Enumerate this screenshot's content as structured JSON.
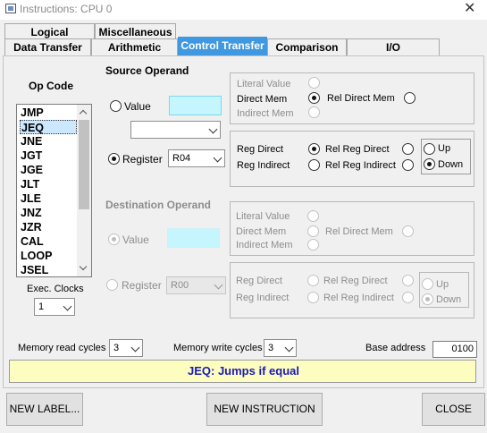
{
  "window": {
    "title": "Instructions: CPU 0",
    "close_glyph": "✕"
  },
  "tabs_row1": [
    "Logical",
    "Miscellaneous"
  ],
  "tabs_row2": [
    "Data Transfer",
    "Arithmetic",
    "Control Transfer",
    "Comparison",
    "I/O"
  ],
  "active_tab": "Control Transfer",
  "opcode": {
    "heading": "Op Code",
    "items": [
      "JMP",
      "JEQ",
      "JNE",
      "JGT",
      "JGE",
      "JLT",
      "JLE",
      "JNZ",
      "JZR",
      "CAL",
      "LOOP",
      "JSEL"
    ],
    "selected": "JEQ",
    "exec_clocks_label": "Exec. Clocks",
    "exec_clocks_value": "1"
  },
  "source": {
    "heading": "Source Operand",
    "value_label": "Value",
    "register_label": "Register",
    "register_value": "R04",
    "literal_label": "Literal Value",
    "direct_mem_label": "Direct Mem",
    "rel_direct_mem_label": "Rel Direct Mem",
    "indirect_mem_label": "Indirect Mem",
    "reg_direct_label": "Reg Direct",
    "rel_reg_direct_label": "Rel Reg Direct",
    "reg_indirect_label": "Reg Indirect",
    "rel_reg_indirect_label": "Rel Reg Indirect",
    "up_label": "Up",
    "down_label": "Down"
  },
  "destination": {
    "heading": "Destination Operand",
    "value_label": "Value",
    "register_label": "Register",
    "register_value": "R00",
    "literal_label": "Literal Value",
    "direct_mem_label": "Direct Mem",
    "rel_direct_mem_label": "Rel Direct Mem",
    "indirect_mem_label": "Indirect Mem",
    "reg_direct_label": "Reg Direct",
    "rel_reg_direct_label": "Rel Reg Direct",
    "reg_indirect_label": "Reg Indirect",
    "rel_reg_indirect_label": "Rel Reg Indirect",
    "up_label": "Up",
    "down_label": "Down"
  },
  "cycles": {
    "read_label": "Memory read cycles",
    "read_value": "3",
    "write_label": "Memory write cycles",
    "write_value": "3",
    "base_label": "Base address",
    "base_value": "0100"
  },
  "status_text": "JEQ: Jumps if equal",
  "buttons": {
    "new_label": "NEW LABEL...",
    "new_instruction": "NEW INSTRUCTION",
    "close": "CLOSE"
  },
  "colors": {
    "active_tab": "#3f98e0",
    "status_bg": "#fdfdc0",
    "status_text": "#1a1ab8",
    "value_box": "#c5f5fd"
  }
}
